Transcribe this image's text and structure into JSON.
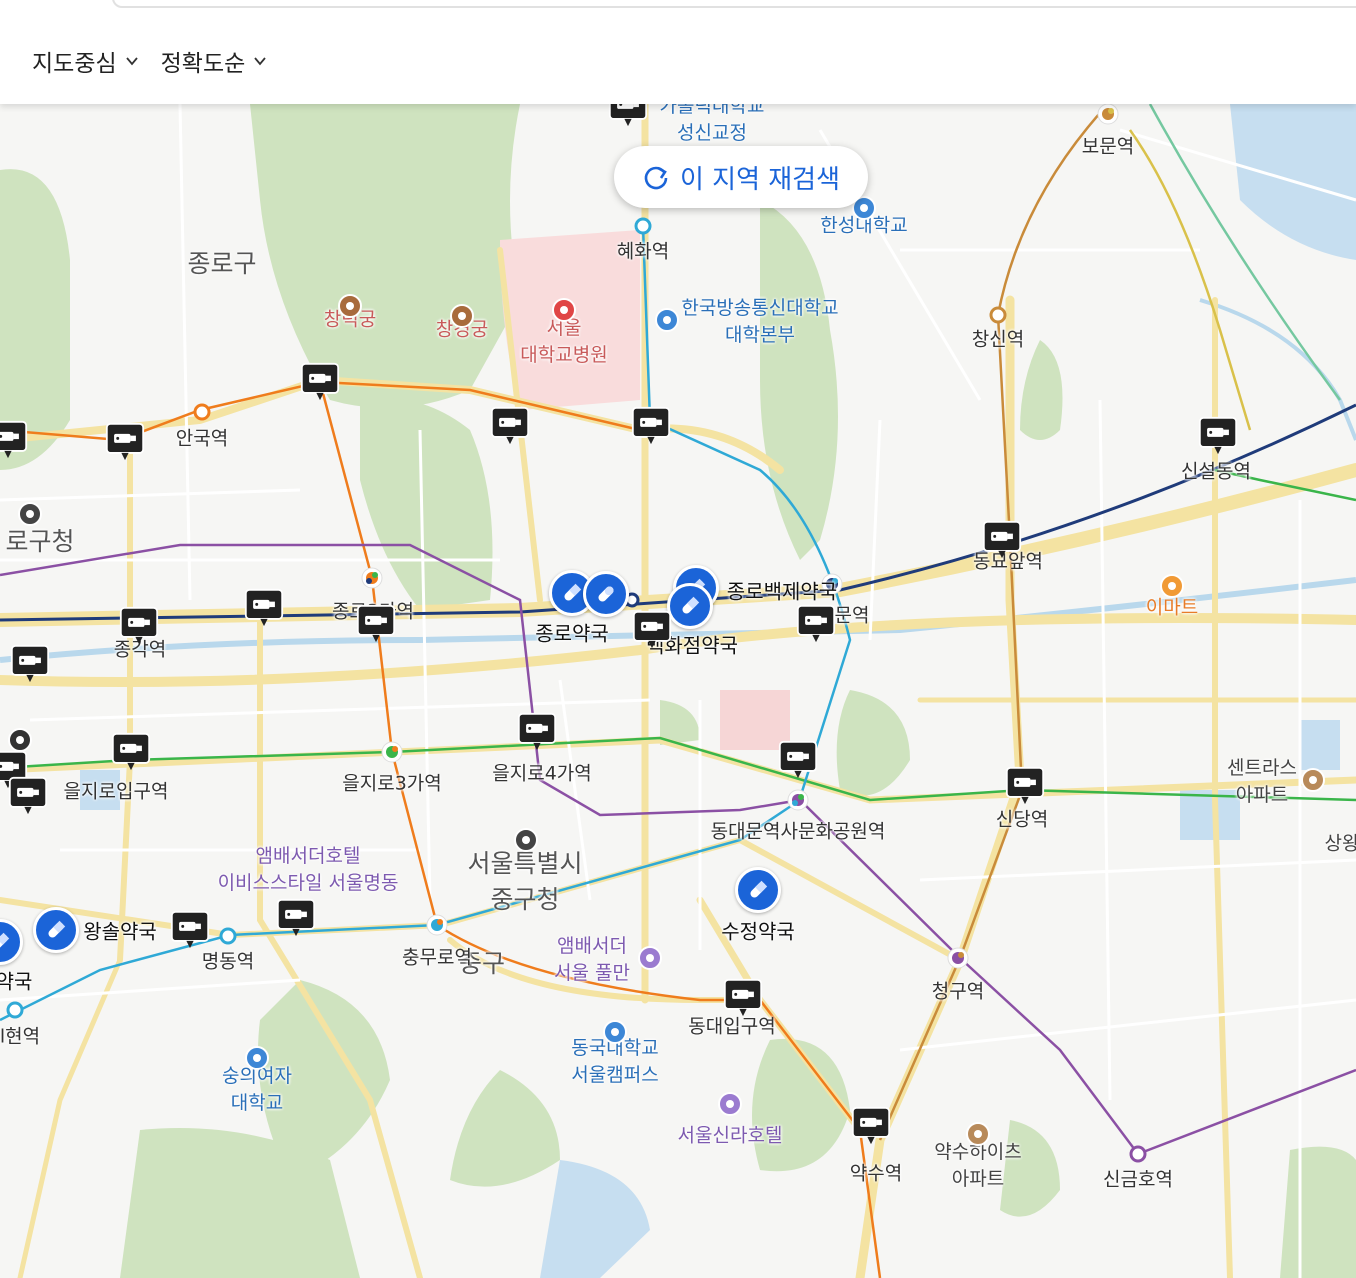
{
  "filters": {
    "sort_center": "지도중심",
    "sort_accuracy": "정확도순"
  },
  "research_button": "이 지역 재검색",
  "colors": {
    "pharmacy_marker": "#1b64d8",
    "cctv_marker": "#222222",
    "subway_line1": "#1f3b7a",
    "subway_line2": "#3ab54a",
    "subway_line3": "#ef7c1c",
    "subway_line4": "#2fa9d6",
    "subway_line5": "#8b50a4",
    "park": "#c6dfb2",
    "water": "#bfdcf2",
    "road": "#f6e6a6"
  },
  "districts": [
    "종로구",
    "중구"
  ],
  "places": [
    {
      "name": "창덕궁",
      "type": "palace"
    },
    {
      "name": "창경궁",
      "type": "palace"
    },
    {
      "name": "서울\n대학교병원",
      "type": "hospital"
    },
    {
      "name": "한성대학교",
      "type": "university"
    },
    {
      "name": "한국방송통신대학교\n대학본부",
      "type": "university"
    },
    {
      "name": "가톨릭대학교\n성신교정",
      "type": "university"
    },
    {
      "name": "이마트",
      "type": "mart"
    },
    {
      "name": "센트라스\n아파트",
      "type": "apartment"
    },
    {
      "name": "앰배서더호텔\n이비스스타일 서울명동",
      "type": "hotel"
    },
    {
      "name": "앰배서더\n서울 풀만",
      "type": "hotel"
    },
    {
      "name": "동국대학교\n서울캠퍼스",
      "type": "university"
    },
    {
      "name": "서울신라호텔",
      "type": "hotel"
    },
    {
      "name": "숭의여자\n대학교",
      "type": "university"
    },
    {
      "name": "약수하이츠\n아파트",
      "type": "apartment"
    },
    {
      "name": "서울특별시\n중구청",
      "type": "government"
    },
    {
      "name": "종로구청",
      "type": "government",
      "display": "로구청"
    },
    {
      "name": "상왕",
      "type": "edge"
    }
  ],
  "stations": [
    "보문역",
    "혜화역",
    "창신역",
    "안국역",
    "신설동역",
    "동묘앞역",
    "종로3가역",
    "종각역",
    "동대문역",
    "을지로입구역",
    "을지로3가역",
    "을지로4가역",
    "동대문역사문화공원역",
    "신당역",
    "충무로역",
    "명동역",
    "회현역",
    "동대입구역",
    "청구역",
    "약수역",
    "신금호역"
  ],
  "pharmacies": [
    {
      "name": "종로약국"
    },
    {
      "name": "종로백제약국"
    },
    {
      "name": "백화점약국"
    },
    {
      "name": "왕솔약국"
    },
    {
      "name": "수정약국"
    },
    {
      "name": "약국"
    }
  ],
  "cctv_count": 24
}
